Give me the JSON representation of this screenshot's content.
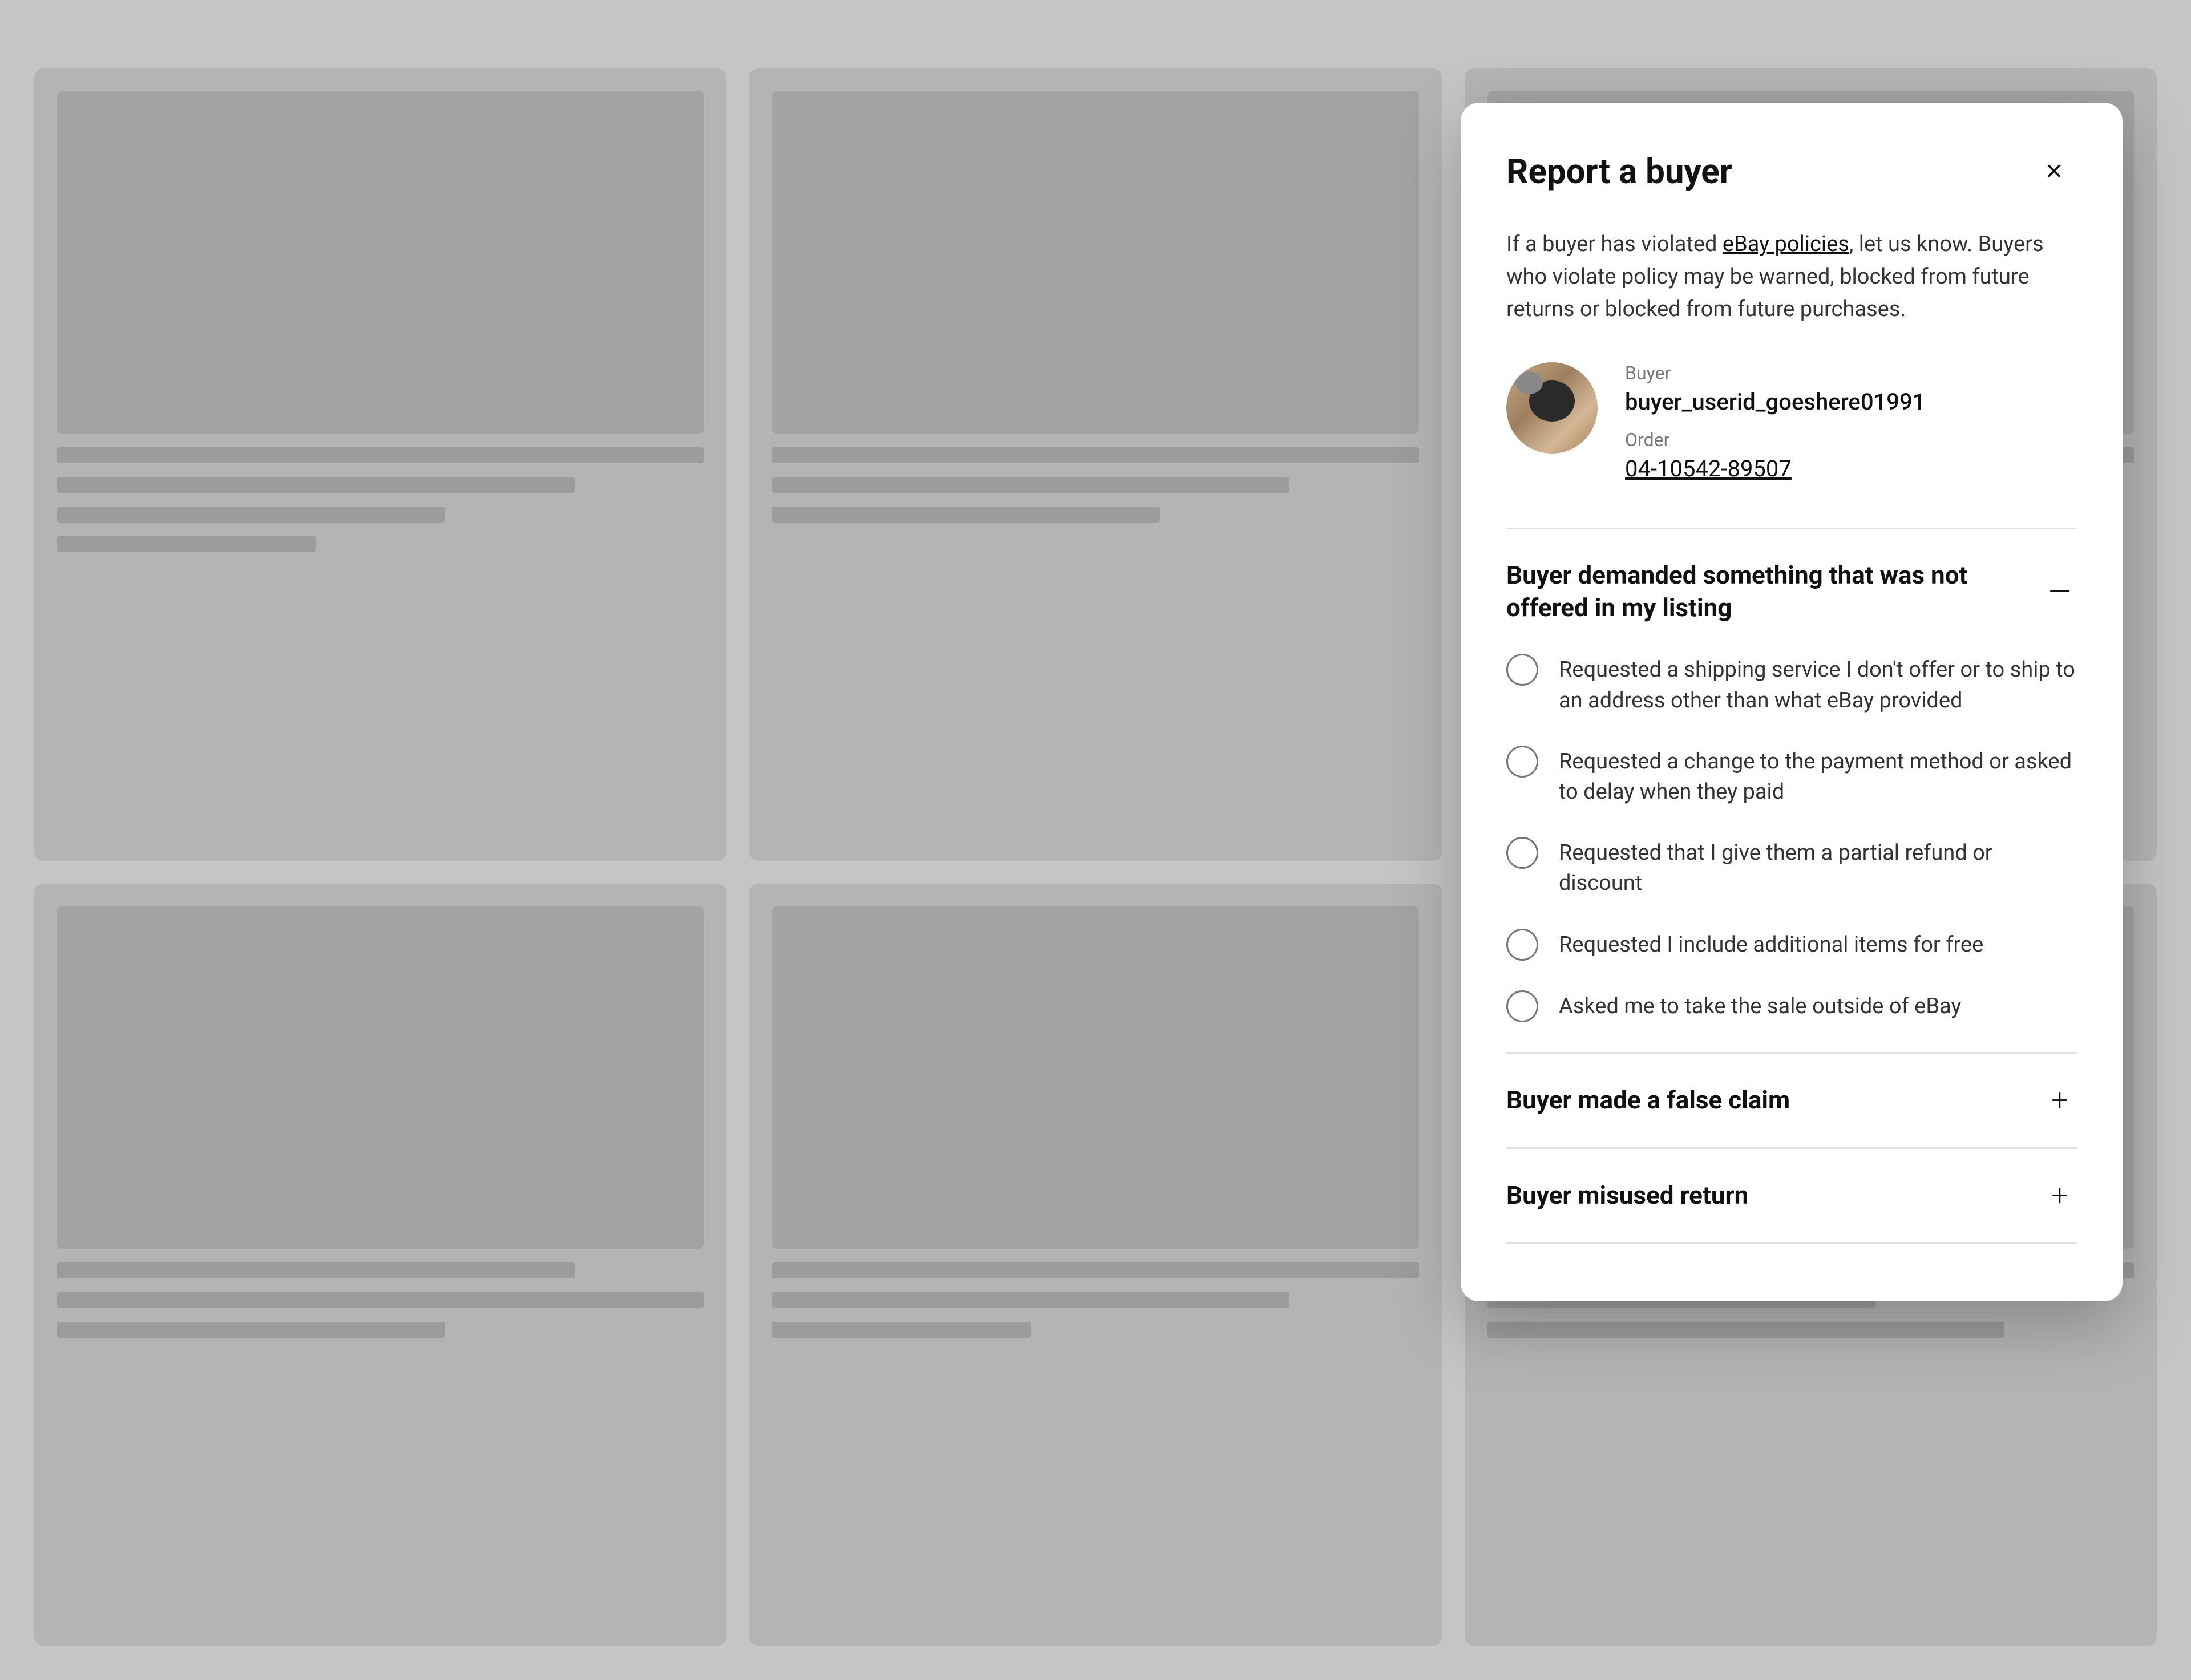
{
  "background": {
    "cards": [
      {
        "lines": [
          "long",
          "medium",
          "short",
          "xshort"
        ]
      },
      {
        "lines": [
          "long",
          "medium",
          "short"
        ]
      },
      {
        "lines": [
          "long",
          "short",
          "medium",
          "xshort"
        ]
      },
      {
        "lines": [
          "medium",
          "long",
          "short"
        ]
      },
      {
        "lines": [
          "long",
          "medium",
          "xshort"
        ]
      },
      {
        "lines": [
          "long",
          "short",
          "medium"
        ]
      }
    ]
  },
  "modal": {
    "title": "Report a buyer",
    "close_label": "×",
    "description_prefix": "If a buyer has violated ",
    "description_link": "eBay policies",
    "description_suffix": ", let us know. Buyers who violate policy may be warned, blocked from future returns or blocked from future purchases.",
    "buyer": {
      "label": "Buyer",
      "name": "buyer_userid_goeshere01991",
      "order_label": "Order",
      "order_number": "04-10542-89507"
    },
    "sections": [
      {
        "id": "section-demanded",
        "title": "Buyer demanded something that was not offered in my listing",
        "expanded": true,
        "icon_expanded": "—",
        "icon_collapsed": "+",
        "options": [
          {
            "id": "opt-shipping",
            "text": "Requested a shipping service I don't offer or to ship to an address other than what eBay provided"
          },
          {
            "id": "opt-payment",
            "text": "Requested a change to the payment method or asked to delay when they paid"
          },
          {
            "id": "opt-refund",
            "text": "Requested that I give them a partial refund or discount"
          },
          {
            "id": "opt-items",
            "text": "Requested I include additional items for free"
          },
          {
            "id": "opt-outside",
            "text": "Asked me to take the sale outside of eBay"
          }
        ]
      },
      {
        "id": "section-false-claim",
        "title": "Buyer made a false claim",
        "expanded": false,
        "icon_expanded": "—",
        "icon_collapsed": "+",
        "options": []
      },
      {
        "id": "section-misused-return",
        "title": "Buyer misused return",
        "expanded": false,
        "icon_expanded": "—",
        "icon_collapsed": "+",
        "options": []
      }
    ]
  }
}
